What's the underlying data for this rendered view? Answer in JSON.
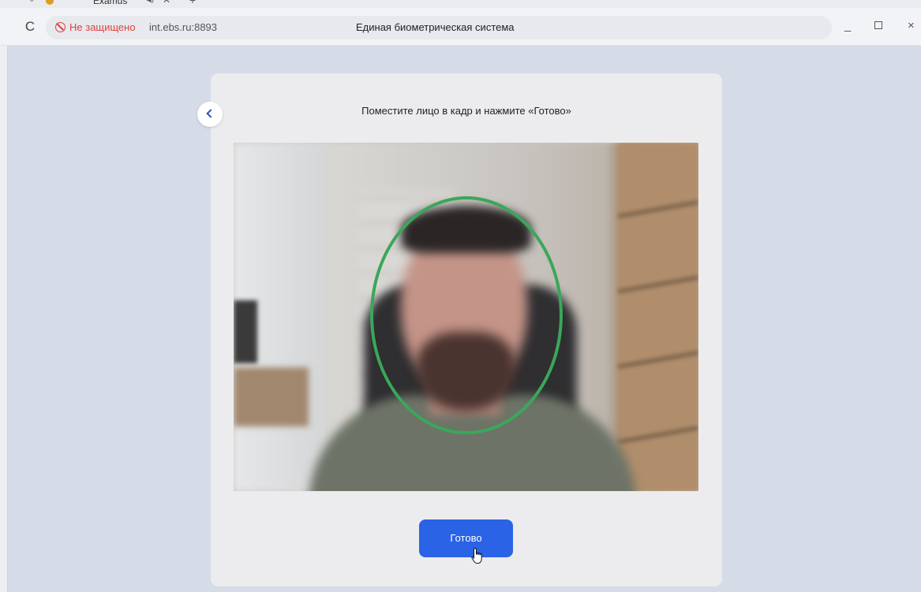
{
  "browser": {
    "tab": {
      "title": "Examus",
      "audio_icon": "speaker-icon",
      "close_glyph": "✕",
      "new_tab_glyph": "+"
    },
    "reload_glyph": "C",
    "security_label": "Не защищено",
    "url": "int.ebs.ru:8893",
    "page_title": "Единая биометрическая система",
    "window_controls": {
      "minimize": "_",
      "close": "×"
    }
  },
  "page": {
    "instruction": "Поместите лицо в кадр и нажмите «Готово»",
    "done_button_label": "Готово",
    "face_guide_color": "#3aa75a",
    "accent_color": "#2a63e6"
  }
}
